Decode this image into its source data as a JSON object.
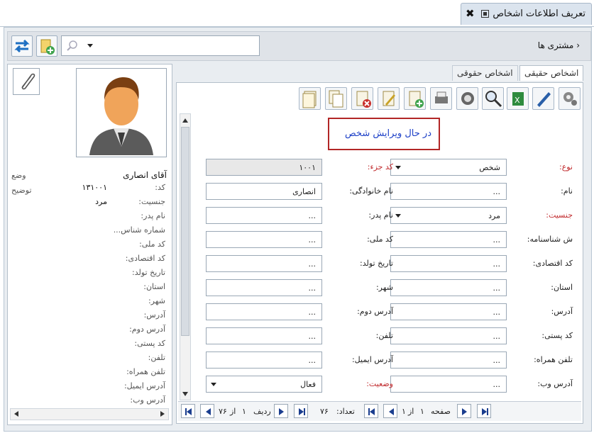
{
  "window": {
    "title": "تعریف اطلاعات اشخاص"
  },
  "breadcrumb": {
    "text": "مشتری ها"
  },
  "tabs": [
    {
      "label": "اشخاص حقیقی"
    },
    {
      "label": "اشخاص حقوقی"
    }
  ],
  "status": {
    "text": "در حال ویرایش شخص"
  },
  "person": {
    "name": "آقای انصاری",
    "fields": [
      {
        "label": "کد:",
        "value": "۱۳۱۰۰۱"
      },
      {
        "label": "جنسیت:",
        "value": "مرد"
      },
      {
        "label": "نام پدر:",
        "value": ""
      },
      {
        "label": "شماره شناس...",
        "value": ""
      },
      {
        "label": "کد ملی:",
        "value": ""
      },
      {
        "label": "کد اقتصادی:",
        "value": ""
      },
      {
        "label": "تاریخ تولد:",
        "value": ""
      },
      {
        "label": "استان:",
        "value": ""
      },
      {
        "label": "شهر:",
        "value": ""
      },
      {
        "label": "آدرس:",
        "value": ""
      },
      {
        "label": "آدرس دوم:",
        "value": ""
      },
      {
        "label": "کد پستی:",
        "value": ""
      },
      {
        "label": "تلفن:",
        "value": ""
      },
      {
        "label": "تلفن همراه:",
        "value": ""
      },
      {
        "label": "آدرس ایمیل:",
        "value": ""
      },
      {
        "label": "آدرس وب:",
        "value": ""
      }
    ],
    "side": [
      "وضع",
      "توضیح"
    ]
  },
  "form": {
    "right": [
      {
        "label": "نوع:",
        "value": "شخص",
        "required": true,
        "dropdown": true
      },
      {
        "label": "نام:",
        "value": "...",
        "required": false,
        "dropdown": false
      },
      {
        "label": "جنسیت:",
        "value": "مرد",
        "required": true,
        "dropdown": true
      },
      {
        "label": "ش شناسنامه:",
        "value": "...",
        "required": false,
        "dropdown": false
      },
      {
        "label": "کد اقتصادی:",
        "value": "...",
        "required": false,
        "dropdown": false
      },
      {
        "label": "استان:",
        "value": "...",
        "required": false,
        "dropdown": false
      },
      {
        "label": "آدرس:",
        "value": "...",
        "required": false,
        "dropdown": false
      },
      {
        "label": "کد پستی:",
        "value": "...",
        "required": false,
        "dropdown": false
      },
      {
        "label": "تلفن همراه:",
        "value": "...",
        "required": false,
        "dropdown": false
      },
      {
        "label": "آدرس وب:",
        "value": "...",
        "required": false,
        "dropdown": false
      }
    ],
    "left": [
      {
        "label": "کد جزء:",
        "value": "۱۰۰۱",
        "required": true,
        "readonly": true,
        "dropdown": false
      },
      {
        "label": "نام خانوادگی:",
        "value": "انصاری",
        "required": false,
        "readonly": false,
        "dropdown": false
      },
      {
        "label": "نام پدر:",
        "value": "...",
        "required": false,
        "readonly": false,
        "dropdown": false
      },
      {
        "label": "کد ملی:",
        "value": "...",
        "required": false,
        "readonly": false,
        "dropdown": false
      },
      {
        "label": "تاریخ تولد:",
        "value": "...",
        "required": false,
        "readonly": false,
        "dropdown": false
      },
      {
        "label": "شهر:",
        "value": "...",
        "required": false,
        "readonly": false,
        "dropdown": false
      },
      {
        "label": "آدرس دوم:",
        "value": "...",
        "required": false,
        "readonly": false,
        "dropdown": false
      },
      {
        "label": "تلفن:",
        "value": "...",
        "required": false,
        "readonly": false,
        "dropdown": false
      },
      {
        "label": "آدرس ایمیل:",
        "value": "...",
        "required": false,
        "readonly": false,
        "dropdown": false
      },
      {
        "label": "وضعیت:",
        "value": "فعال",
        "required": true,
        "readonly": false,
        "dropdown": true
      }
    ]
  },
  "pager": {
    "page_label": "صفحه",
    "page_current": "۱",
    "of_label": "از",
    "page_total": "۱",
    "count_label": "تعداد:",
    "count": "۷۶",
    "row_label": "ردیف",
    "row_current": "۱",
    "row_total": "۷۶"
  },
  "toolbar": [
    "settings-icon",
    "edit-pen-icon",
    "excel-export-icon",
    "search-zoom-icon",
    "refresh-icon",
    "print-icon",
    "add-document-icon",
    "edit-document-icon",
    "delete-document-icon",
    "copy-document-icon",
    "duplicate-document-icon"
  ]
}
